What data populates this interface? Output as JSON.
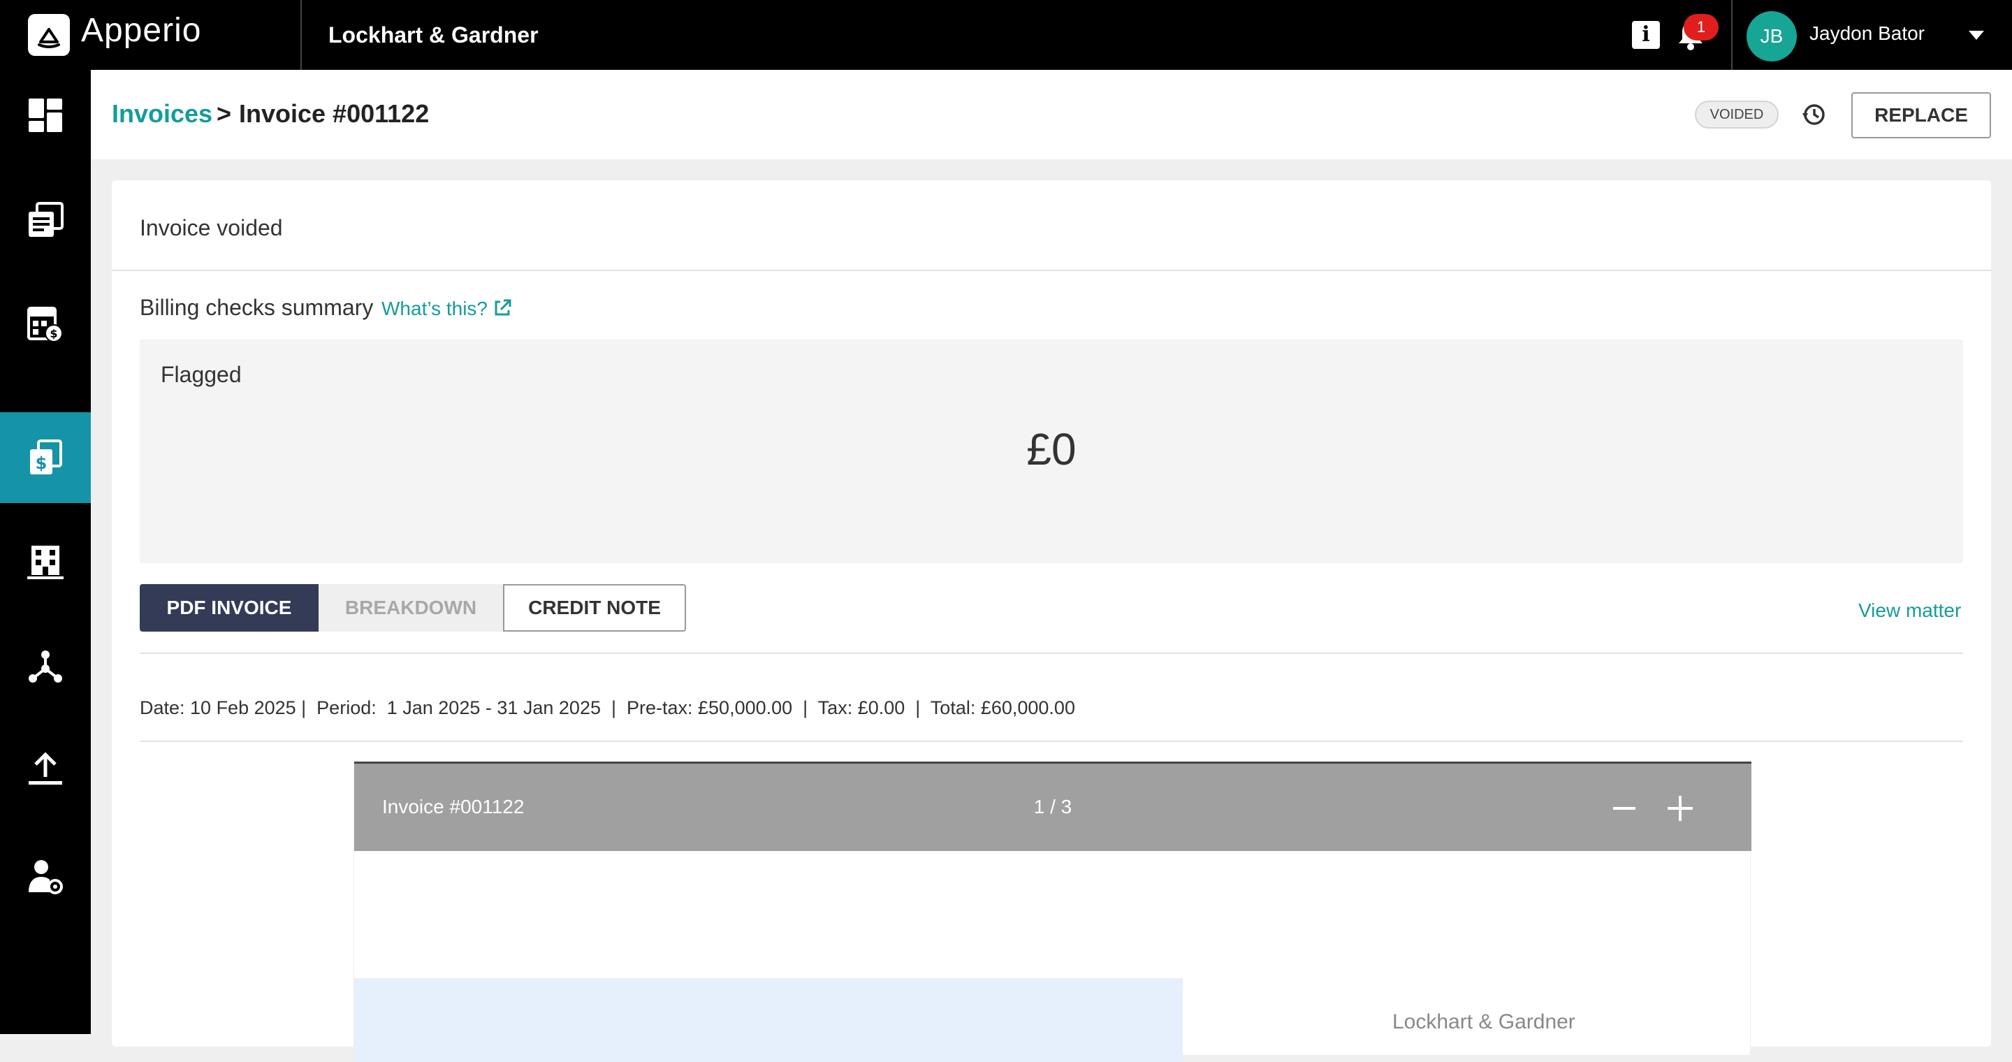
{
  "topbar": {
    "app_name": "Apperio",
    "firm_name": "Lockhart & Gardner",
    "info_label": "i",
    "notification_count": "1",
    "user_initials": "JB",
    "user_name": "Jaydon Bator"
  },
  "sidebar": {
    "items": [
      {
        "name": "dashboard-icon",
        "active": false
      },
      {
        "name": "documents-icon",
        "active": false
      },
      {
        "name": "billing-calculator-icon",
        "active": false
      },
      {
        "name": "invoices-icon",
        "active": true
      },
      {
        "name": "building-icon",
        "active": false
      },
      {
        "name": "network-icon",
        "active": false
      },
      {
        "name": "upload-icon",
        "active": false
      },
      {
        "name": "user-settings-icon",
        "active": false
      }
    ]
  },
  "header": {
    "breadcrumb_link": "Invoices",
    "breadcrumb_sep": ">",
    "breadcrumb_current": "Invoice #001122",
    "status": "VOIDED",
    "replace_label": "REPLACE"
  },
  "card": {
    "title": "Invoice voided",
    "billing_title": "Billing checks summary",
    "whats_this": "What’s this?",
    "flagged_label": "Flagged",
    "flagged_value": "£0",
    "tabs": {
      "pdf": "PDF INVOICE",
      "breakdown": "BREAKDOWN",
      "credit": "CREDIT NOTE"
    },
    "view_matter": "View matter",
    "summary": "Date: 10 Feb 2025 |  Period:  1 Jan 2025 - 31 Jan 2025  |  Pre-tax: £50,000.00  |  Tax: £0.00  |  Total: £60,000.00"
  },
  "pdf": {
    "title": "Invoice #001122",
    "page": "1 / 3",
    "firm": "Lockhart & Gardner"
  },
  "colors": {
    "accent": "#149c9c",
    "active_nav": "#1594a7",
    "tab_active": "#333b57",
    "badge": "#e01e1e"
  }
}
